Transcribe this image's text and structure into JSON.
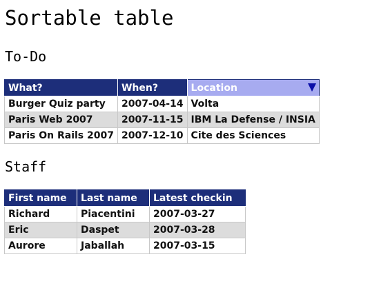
{
  "page": {
    "title": "Sortable table"
  },
  "todo": {
    "title": "To-Do",
    "headers": [
      "What?",
      "When?",
      "Location"
    ],
    "sorted_column": "Location",
    "rows": [
      [
        "Burger Quiz party",
        "2007-04-14",
        "Volta"
      ],
      [
        "Paris Web 2007",
        "2007-11-15",
        "IBM La Defense / INSIA"
      ],
      [
        "Paris On Rails 2007",
        "2007-12-10",
        "Cite des Sciences"
      ]
    ]
  },
  "staff": {
    "title": "Staff",
    "headers": [
      "First name",
      "Last name",
      "Latest checkin"
    ],
    "rows": [
      [
        "Richard",
        "Piacentini",
        "2007-03-27"
      ],
      [
        "Eric",
        "Daspet",
        "2007-03-28"
      ],
      [
        "Aurore",
        "Jaballah",
        "2007-03-15"
      ]
    ]
  },
  "colors": {
    "header_bg": "#1d2e7a",
    "header_sorted_bg": "#a7abf0",
    "sort_arrow": "#0a0ea8",
    "row_alt_bg": "#dcdcdc"
  },
  "icons": {
    "sort_indicator": "sort-descending-arrow-icon"
  }
}
